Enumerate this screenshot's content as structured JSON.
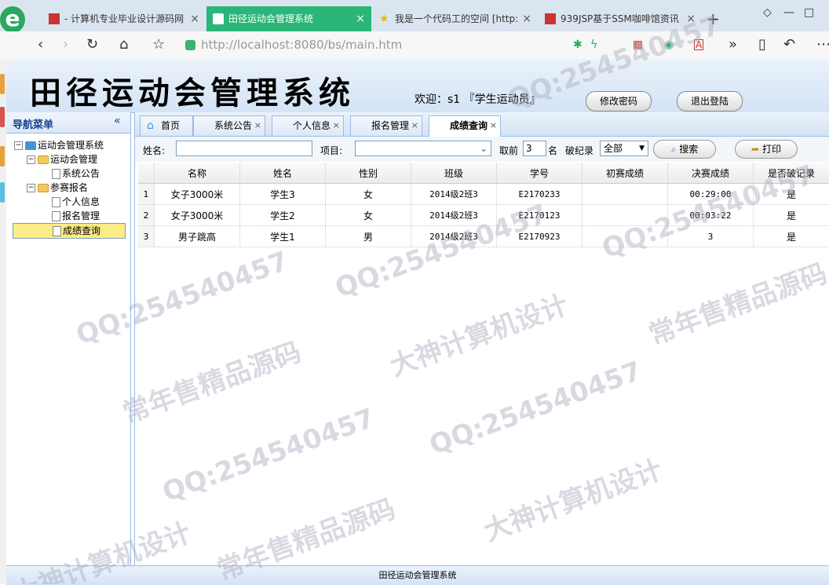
{
  "browser": {
    "tabs": [
      {
        "label": "- 计算机专业毕业设计源码网",
        "active": false
      },
      {
        "label": "田径运动会管理系统",
        "active": true
      },
      {
        "label": "我是一个代码工的空间 [http:",
        "active": false
      },
      {
        "label": "939JSP基于SSM咖啡馆资讯",
        "active": false
      }
    ],
    "new_tab": "+",
    "url_host": "http://localhost",
    "url_rest": ":8080/bs/main.htm"
  },
  "app": {
    "title": "田径运动会管理系统",
    "welcome": "欢迎：s1 『学生运动员』",
    "change_password": "修改密码",
    "logout": "退出登陆"
  },
  "nav": {
    "title": "导航菜单",
    "collapse": "«",
    "root": "运动会管理系统",
    "groups": [
      {
        "label": "运动会管理",
        "items": [
          "系统公告"
        ]
      },
      {
        "label": "参赛报名",
        "items": [
          "个人信息",
          "报名管理",
          "成绩查询"
        ]
      }
    ]
  },
  "tabs": [
    "首页",
    "系统公告",
    "个人信息",
    "报名管理",
    "成绩查询"
  ],
  "toolbar": {
    "name_label": "姓名:",
    "name_value": "",
    "event_label": "项目:",
    "event_value": "",
    "top_label": "取前",
    "top_value": "3",
    "top_unit": "名",
    "record_label": "破纪录",
    "record_value": "全部",
    "search": "搜索",
    "print": "打印"
  },
  "table": {
    "columns": [
      "名称",
      "姓名",
      "性别",
      "班级",
      "学号",
      "初赛成绩",
      "决赛成绩",
      "是否破记录"
    ],
    "rows": [
      [
        "1",
        "女子3000米",
        "学生3",
        "女",
        "2014级2班3",
        "E2170233",
        "",
        "00:29:00",
        "是"
      ],
      [
        "2",
        "女子3000米",
        "学生2",
        "女",
        "2014级2班3",
        "E2170123",
        "",
        "00:03:22",
        "是"
      ],
      [
        "3",
        "男子跳高",
        "学生1",
        "男",
        "2014级2班3",
        "E2170923",
        "",
        "3",
        "是"
      ]
    ]
  },
  "footer": "田径运动会管理系统",
  "watermark": [
    "QQ:254540457",
    "常年售精品源码",
    "大神计算机设计"
  ]
}
